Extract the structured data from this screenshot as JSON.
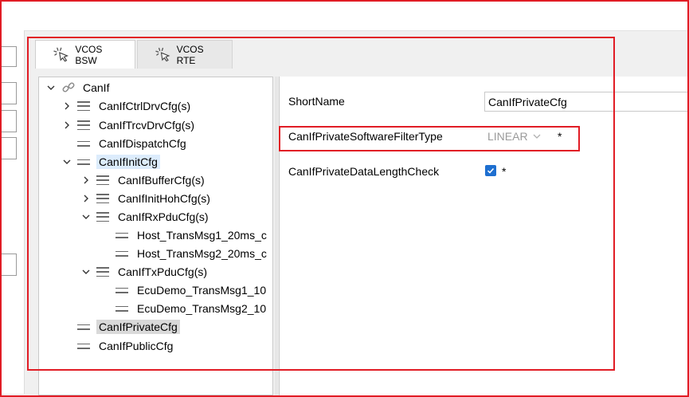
{
  "tabs": [
    {
      "label": "VCOS BSW",
      "active": true
    },
    {
      "label": "VCOS RTE",
      "active": false
    }
  ],
  "tree": {
    "root": "CanIf",
    "ctrl": "CanIfCtrlDrvCfg(s)",
    "trcv": "CanIfTrcvDrvCfg(s)",
    "dispatch": "CanIfDispatchCfg",
    "init": "CanIfInitCfg",
    "buffer": "CanIfBufferCfg(s)",
    "inithoh": "CanIfInitHohCfg(s)",
    "rxpdu": "CanIfRxPduCfg(s)",
    "rx1": "Host_TransMsg1_20ms_c",
    "rx2": "Host_TransMsg2_20ms_c",
    "txpdu": "CanIfTxPduCfg(s)",
    "tx1": "EcuDemo_TransMsg1_10",
    "tx2": "EcuDemo_TransMsg2_10",
    "private": "CanIfPrivateCfg",
    "public": "CanIfPublicCfg"
  },
  "props": {
    "shortname_label": "ShortName",
    "shortname_value": "CanIfPrivateCfg",
    "filter_label": "CanIfPrivateSoftwareFilterType",
    "filter_value": "LINEAR",
    "filter_required": "*",
    "dlc_label": "CanIfPrivateDataLengthCheck",
    "dlc_checked": true,
    "dlc_required": "*"
  },
  "colors": {
    "highlight_red": "#e11c25",
    "checkbox_blue": "#1e6fd0",
    "selection_blue": "#dcecfc",
    "selection_gray": "#d9d9d9"
  }
}
